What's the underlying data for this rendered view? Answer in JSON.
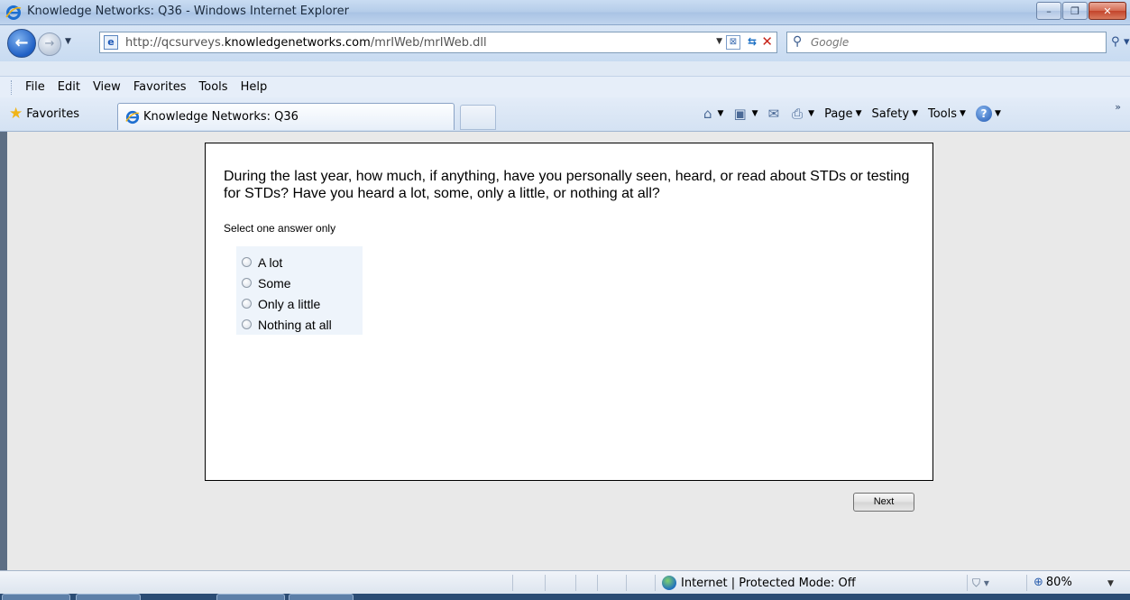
{
  "window": {
    "title": "Knowledge Networks: Q36 - Windows Internet Explorer",
    "controls": {
      "minimize": "–",
      "maximize": "❐",
      "close": "✕"
    }
  },
  "navigation": {
    "back_glyph": "←",
    "forward_glyph": "→",
    "address_prefix": "http://qcsurveys.",
    "address_domain": "knowledgenetworks.com",
    "address_path": "/mrIWeb/mrIWeb.dll",
    "search_placeholder": "Google"
  },
  "menu": {
    "items": [
      "File",
      "Edit",
      "View",
      "Favorites",
      "Tools",
      "Help"
    ]
  },
  "tabs": {
    "favorites_label": "Favorites",
    "active_tab": "Knowledge Networks: Q36"
  },
  "commands": {
    "page": "Page",
    "safety": "Safety",
    "tools": "Tools"
  },
  "survey": {
    "question": "During the last year, how much, if anything, have you personally seen, heard, or read about STDs or testing for STDs? Have you heard a lot, some, only a little, or nothing at all?",
    "instruction": "Select one answer only",
    "options": [
      "A lot",
      "Some",
      "Only a little",
      "Nothing at all"
    ],
    "selected": null,
    "next_label": "Next"
  },
  "status": {
    "zone": "Internet | Protected Mode: Off",
    "zoom": "80%"
  },
  "icons": {
    "back": "back-arrow-icon",
    "forward": "forward-arrow-icon",
    "page": "page-icon",
    "search": "search-icon",
    "home": "home-icon",
    "feeds": "feeds-icon",
    "mail": "mail-icon",
    "print": "print-icon",
    "help": "help-icon",
    "globe": "globe-icon"
  },
  "colors": {
    "titlebar": "#b4cce9",
    "content_bg": "#e9e9e9",
    "answers_bg": "#eef4fb",
    "close_button": "#c3442b"
  }
}
